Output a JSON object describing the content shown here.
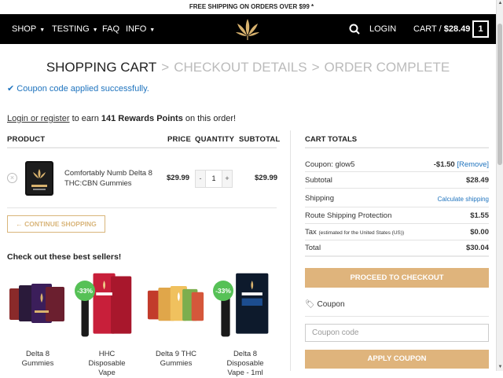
{
  "topbar": {
    "text": "FREE SHIPPING ON ORDERS OVER $99 *"
  },
  "nav": {
    "shop": "SHOP",
    "testing": "TESTING",
    "faq": "FAQ",
    "info": "INFO",
    "login": "LOGIN",
    "cart_label": "CART /",
    "cart_total": "$28.49",
    "cart_count": "1"
  },
  "breadcrumb": {
    "step1": "SHOPPING CART",
    "step2": "CHECKOUT DETAILS",
    "step3": "ORDER COMPLETE",
    "separator": ">"
  },
  "notice": {
    "text": "Coupon code applied successfully."
  },
  "rewards": {
    "link": "Login or register",
    "pre": "to earn",
    "points": "141 Rewards Points",
    "post": "on this order!"
  },
  "table": {
    "headers": {
      "product": "PRODUCT",
      "price": "PRICE",
      "quantity": "QUANTITY",
      "subtotal": "SUBTOTAL"
    },
    "item": {
      "name": "Comfortably Numb Delta 8 THC:CBN Gummies",
      "price": "$29.99",
      "qty": "1",
      "subtotal": "$29.99",
      "minus": "-",
      "plus": "+"
    }
  },
  "continue_btn": "← CONTINUE SHOPPING",
  "best_sellers": {
    "title": "Check out these best sellers!",
    "products": [
      {
        "label_l1": "Delta 8",
        "label_l2": "Gummies"
      },
      {
        "label_l1": "HHC",
        "label_l2": "Disposable",
        "label_l3": "Vape",
        "badge": "-33%"
      },
      {
        "label_l1": "Delta 9 THC",
        "label_l2": "Gummies"
      },
      {
        "label_l1": "Delta 8",
        "label_l2": "Disposable",
        "label_l3": "Vape - 1ml",
        "badge": "-33%"
      }
    ]
  },
  "totals": {
    "title": "CART TOTALS",
    "coupon_label": "Coupon: glow5",
    "coupon_value": "-$1.50",
    "coupon_remove": "[Remove]",
    "subtotal_label": "Subtotal",
    "subtotal_value": "$28.49",
    "shipping_label": "Shipping",
    "shipping_value": "Calculate shipping",
    "route_label": "Route Shipping Protection",
    "route_value": "$1.55",
    "tax_label": "Tax",
    "tax_note": "(estimated for the United States (US))",
    "tax_value": "$0.00",
    "total_label": "Total",
    "total_value": "$30.04",
    "checkout_btn": "PROCEED TO CHECKOUT"
  },
  "coupon": {
    "label": "Coupon",
    "placeholder": "Coupon code",
    "apply_btn": "APPLY COUPON"
  },
  "colors": {
    "accent": "#dfb47c",
    "link": "#1e73be",
    "badge": "#56c156",
    "nav_bg": "#000000"
  }
}
